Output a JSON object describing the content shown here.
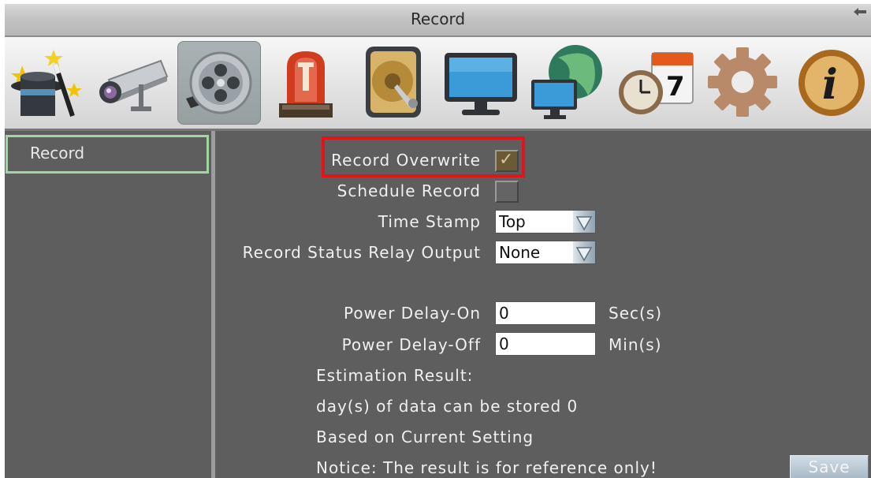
{
  "window": {
    "title": "Record"
  },
  "toolbar": {
    "icons": [
      "wizard-icon",
      "camera-icon",
      "record-icon",
      "alarm-icon",
      "storage-icon",
      "display-icon",
      "network-icon",
      "schedule-icon",
      "settings-icon",
      "info-icon"
    ],
    "calendar_day": "7",
    "info_glyph": "i"
  },
  "sidebar": {
    "items": [
      {
        "label": "Record",
        "selected": true
      }
    ]
  },
  "form": {
    "record_overwrite": {
      "label": "Record Overwrite",
      "checked": true
    },
    "schedule_record": {
      "label": "Schedule Record",
      "checked": false
    },
    "time_stamp": {
      "label": "Time Stamp",
      "value": "Top"
    },
    "record_status_relay_output": {
      "label": "Record Status Relay Output",
      "value": "None"
    },
    "power_delay_on": {
      "label": "Power Delay-On",
      "value": "0",
      "unit": "Sec(s)"
    },
    "power_delay_off": {
      "label": "Power Delay-Off",
      "value": "0",
      "unit": "Min(s)"
    }
  },
  "estimation": {
    "heading": "Estimation Result:",
    "days_line": "day(s) of data can be stored 0",
    "basis": "Based on Current Setting",
    "notice": "Notice: The result is for reference only!"
  },
  "actions": {
    "save_label": "Save"
  },
  "colors": {
    "panel": "#5e5e5e",
    "highlight": "#e0141a",
    "selected_border": "#9ed7a0"
  }
}
